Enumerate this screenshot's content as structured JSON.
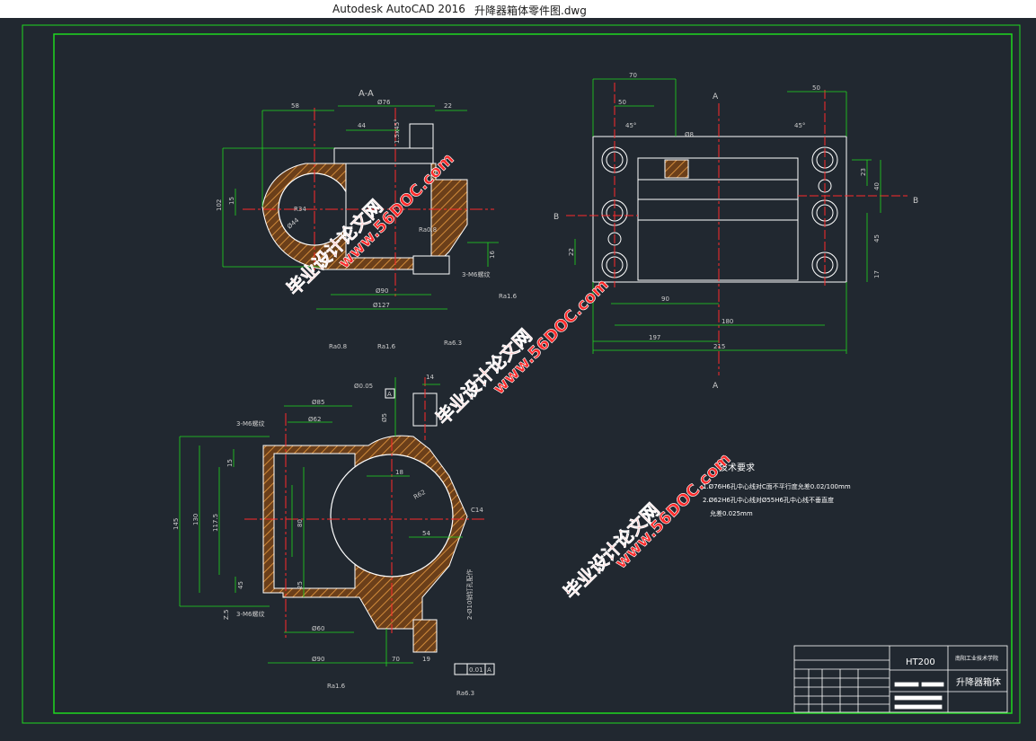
{
  "window": {
    "app_title": "Autodesk AutoCAD 2016",
    "file_name": "升降器箱体零件图.dwg"
  },
  "colors": {
    "background": "#212830",
    "border": "#1fd81f",
    "outline": "#ffffff",
    "dimension": "#1fd81f",
    "centerline": "#ff2a2a",
    "hatch": "#b06a2a",
    "watermark": "#ff2b2b"
  },
  "drawing": {
    "section_aa": {
      "label": "A-A",
      "dims": {
        "d58": "58",
        "d76": "Ø76",
        "d22": "22",
        "d44": "44",
        "d1x45": "1.5x45°",
        "d102": "102",
        "d15": "15",
        "r34": "R34",
        "d44b": "Ø44",
        "d16": "16",
        "d90": "Ø90",
        "d127": "Ø127",
        "m6": "3-M6螺纹",
        "ra16": "Ra1.6",
        "ra08": "Ra0.8"
      }
    },
    "top_view": {
      "section_a_top": "A",
      "section_a_bottom": "A",
      "section_b_left": "B",
      "section_b_right": "B",
      "dims": {
        "d70": "70",
        "d50a": "50",
        "d50b": "50",
        "d45a": "45°",
        "d45b": "45°",
        "d8": "Ø8",
        "d23": "23",
        "d40": "40",
        "d45": "45",
        "d17": "17",
        "d22": "22",
        "d90": "90",
        "d180": "180",
        "d197": "197",
        "d215": "215"
      }
    },
    "section_bb": {
      "dims": {
        "ra08": "Ra0.8",
        "ra16a": "Ra1.6",
        "ra63a": "Ra6.3",
        "d14": "14",
        "tol1": "Ø0.05",
        "d85": "Ø85",
        "d62": "Ø62",
        "m6a": "3-M6螺纹",
        "d145": "145",
        "d130": "130",
        "d1175": "117.5",
        "d80": "80",
        "d15": "15",
        "d18": "18",
        "r62": "R62",
        "d54": "54",
        "c14": "C14",
        "d5": "5",
        "d25": "25",
        "d45": "45",
        "d2": "Z.5",
        "m6b": "3-M6螺纹",
        "d60": "Ø60",
        "d90": "Ø90",
        "d10": "2-Ø10销钉孔配作",
        "d19": "19",
        "d70": "70",
        "tol2": "0.01",
        "tolref": "A",
        "ra16b": "Ra1.6",
        "ra63b": "Ra6.3",
        "d35": "Ø5",
        "refA": "A"
      }
    },
    "tech_requirements": {
      "title": "技术要求",
      "line1": "1.Ø76H6孔中心线对C面不平行度允差0.02/100mm",
      "line2": "2.Ø62H6孔中心线对Ø55H6孔中心线不垂直度",
      "line3": "允差0.025mm"
    },
    "title_block": {
      "material": "HT200",
      "school": "南阳工业技术学院",
      "part_name": "升降器箱体"
    },
    "watermarks": [
      {
        "text": "毕业设计论文网"
      },
      {
        "text": "www.56DOC.com"
      }
    ]
  }
}
